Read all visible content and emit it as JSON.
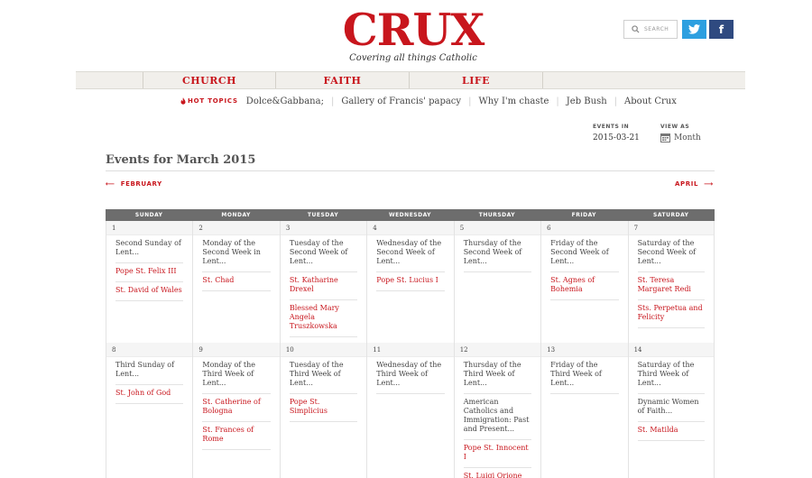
{
  "brand": {
    "logo": "CRUX",
    "tagline": "Covering all things Catholic",
    "accent": "#c8161d"
  },
  "search": {
    "label": "SEARCH"
  },
  "nav": [
    "CHURCH",
    "FAITH",
    "LIFE"
  ],
  "hot_topics": {
    "label": "HOT TOPICS",
    "items": [
      "Dolce&Gabbana;",
      "Gallery of Francis' papacy",
      "Why I'm chaste",
      "Jeb Bush",
      "About Crux"
    ]
  },
  "events_in": {
    "label": "EVENTS IN",
    "value": "2015-03-21"
  },
  "view_as": {
    "label": "VIEW AS",
    "value": "Month"
  },
  "calendar": {
    "title": "Events for March 2015",
    "prev": "FEBRUARY",
    "next": "APRIL",
    "days_of_week": [
      "SUNDAY",
      "MONDAY",
      "TUESDAY",
      "WEDNESDAY",
      "THURSDAY",
      "FRIDAY",
      "SATURDAY"
    ],
    "weeks": [
      [
        {
          "num": "1",
          "events": [
            {
              "text": "Second Sunday of Lent...",
              "color": "dark"
            },
            {
              "text": "Pope St. Felix III",
              "color": "red"
            },
            {
              "text": "St. David of Wales",
              "color": "red"
            }
          ]
        },
        {
          "num": "2",
          "events": [
            {
              "text": "Monday of the Second Week in Lent...",
              "color": "dark"
            },
            {
              "text": "St. Chad",
              "color": "red"
            }
          ]
        },
        {
          "num": "3",
          "events": [
            {
              "text": "Tuesday of the Second Week of Lent...",
              "color": "dark"
            },
            {
              "text": "St. Katharine Drexel",
              "color": "red"
            },
            {
              "text": "Blessed Mary Angela Truszkowska",
              "color": "red"
            }
          ]
        },
        {
          "num": "4",
          "events": [
            {
              "text": "Wednesday of the Second Week of Lent...",
              "color": "dark"
            },
            {
              "text": "Pope St. Lucius I",
              "color": "red"
            }
          ]
        },
        {
          "num": "5",
          "events": [
            {
              "text": "Thursday of the Second Week of Lent...",
              "color": "dark"
            }
          ]
        },
        {
          "num": "6",
          "events": [
            {
              "text": "Friday of the Second Week of Lent...",
              "color": "dark"
            },
            {
              "text": "St. Agnes of Bohemia",
              "color": "red"
            }
          ]
        },
        {
          "num": "7",
          "events": [
            {
              "text": "Saturday of the Second Week of Lent...",
              "color": "dark"
            },
            {
              "text": "St. Teresa Margaret Redi",
              "color": "red"
            },
            {
              "text": "Sts. Perpetua and Felicity",
              "color": "red"
            }
          ]
        }
      ],
      [
        {
          "num": "8",
          "events": [
            {
              "text": "Third Sunday of Lent...",
              "color": "dark"
            },
            {
              "text": "St. John of God",
              "color": "red"
            }
          ]
        },
        {
          "num": "9",
          "events": [
            {
              "text": "Monday of the Third Week of Lent...",
              "color": "dark"
            },
            {
              "text": "St. Catherine of Bologna",
              "color": "red"
            },
            {
              "text": "St. Frances of Rome",
              "color": "red"
            }
          ]
        },
        {
          "num": "10",
          "events": [
            {
              "text": "Tuesday of the Third Week of Lent...",
              "color": "dark"
            },
            {
              "text": "Pope St. Simplicius",
              "color": "red"
            }
          ]
        },
        {
          "num": "11",
          "events": [
            {
              "text": "Wednesday of the Third Week of Lent...",
              "color": "dark"
            }
          ]
        },
        {
          "num": "12",
          "events": [
            {
              "text": "Thursday of the Third Week of Lent...",
              "color": "dark"
            },
            {
              "text": "American Catholics and Immigration: Past and Present...",
              "color": "dark"
            },
            {
              "text": "Pope St. Innocent I",
              "color": "red"
            },
            {
              "text": "St. Luigi Orione",
              "color": "red"
            }
          ]
        },
        {
          "num": "13",
          "events": [
            {
              "text": "Friday of the Third Week of Lent...",
              "color": "dark"
            }
          ]
        },
        {
          "num": "14",
          "events": [
            {
              "text": "Saturday of the Third Week of Lent...",
              "color": "dark"
            },
            {
              "text": "Dynamic Women of Faith...",
              "color": "dark"
            },
            {
              "text": "St. Matilda",
              "color": "red"
            }
          ]
        }
      ]
    ]
  }
}
